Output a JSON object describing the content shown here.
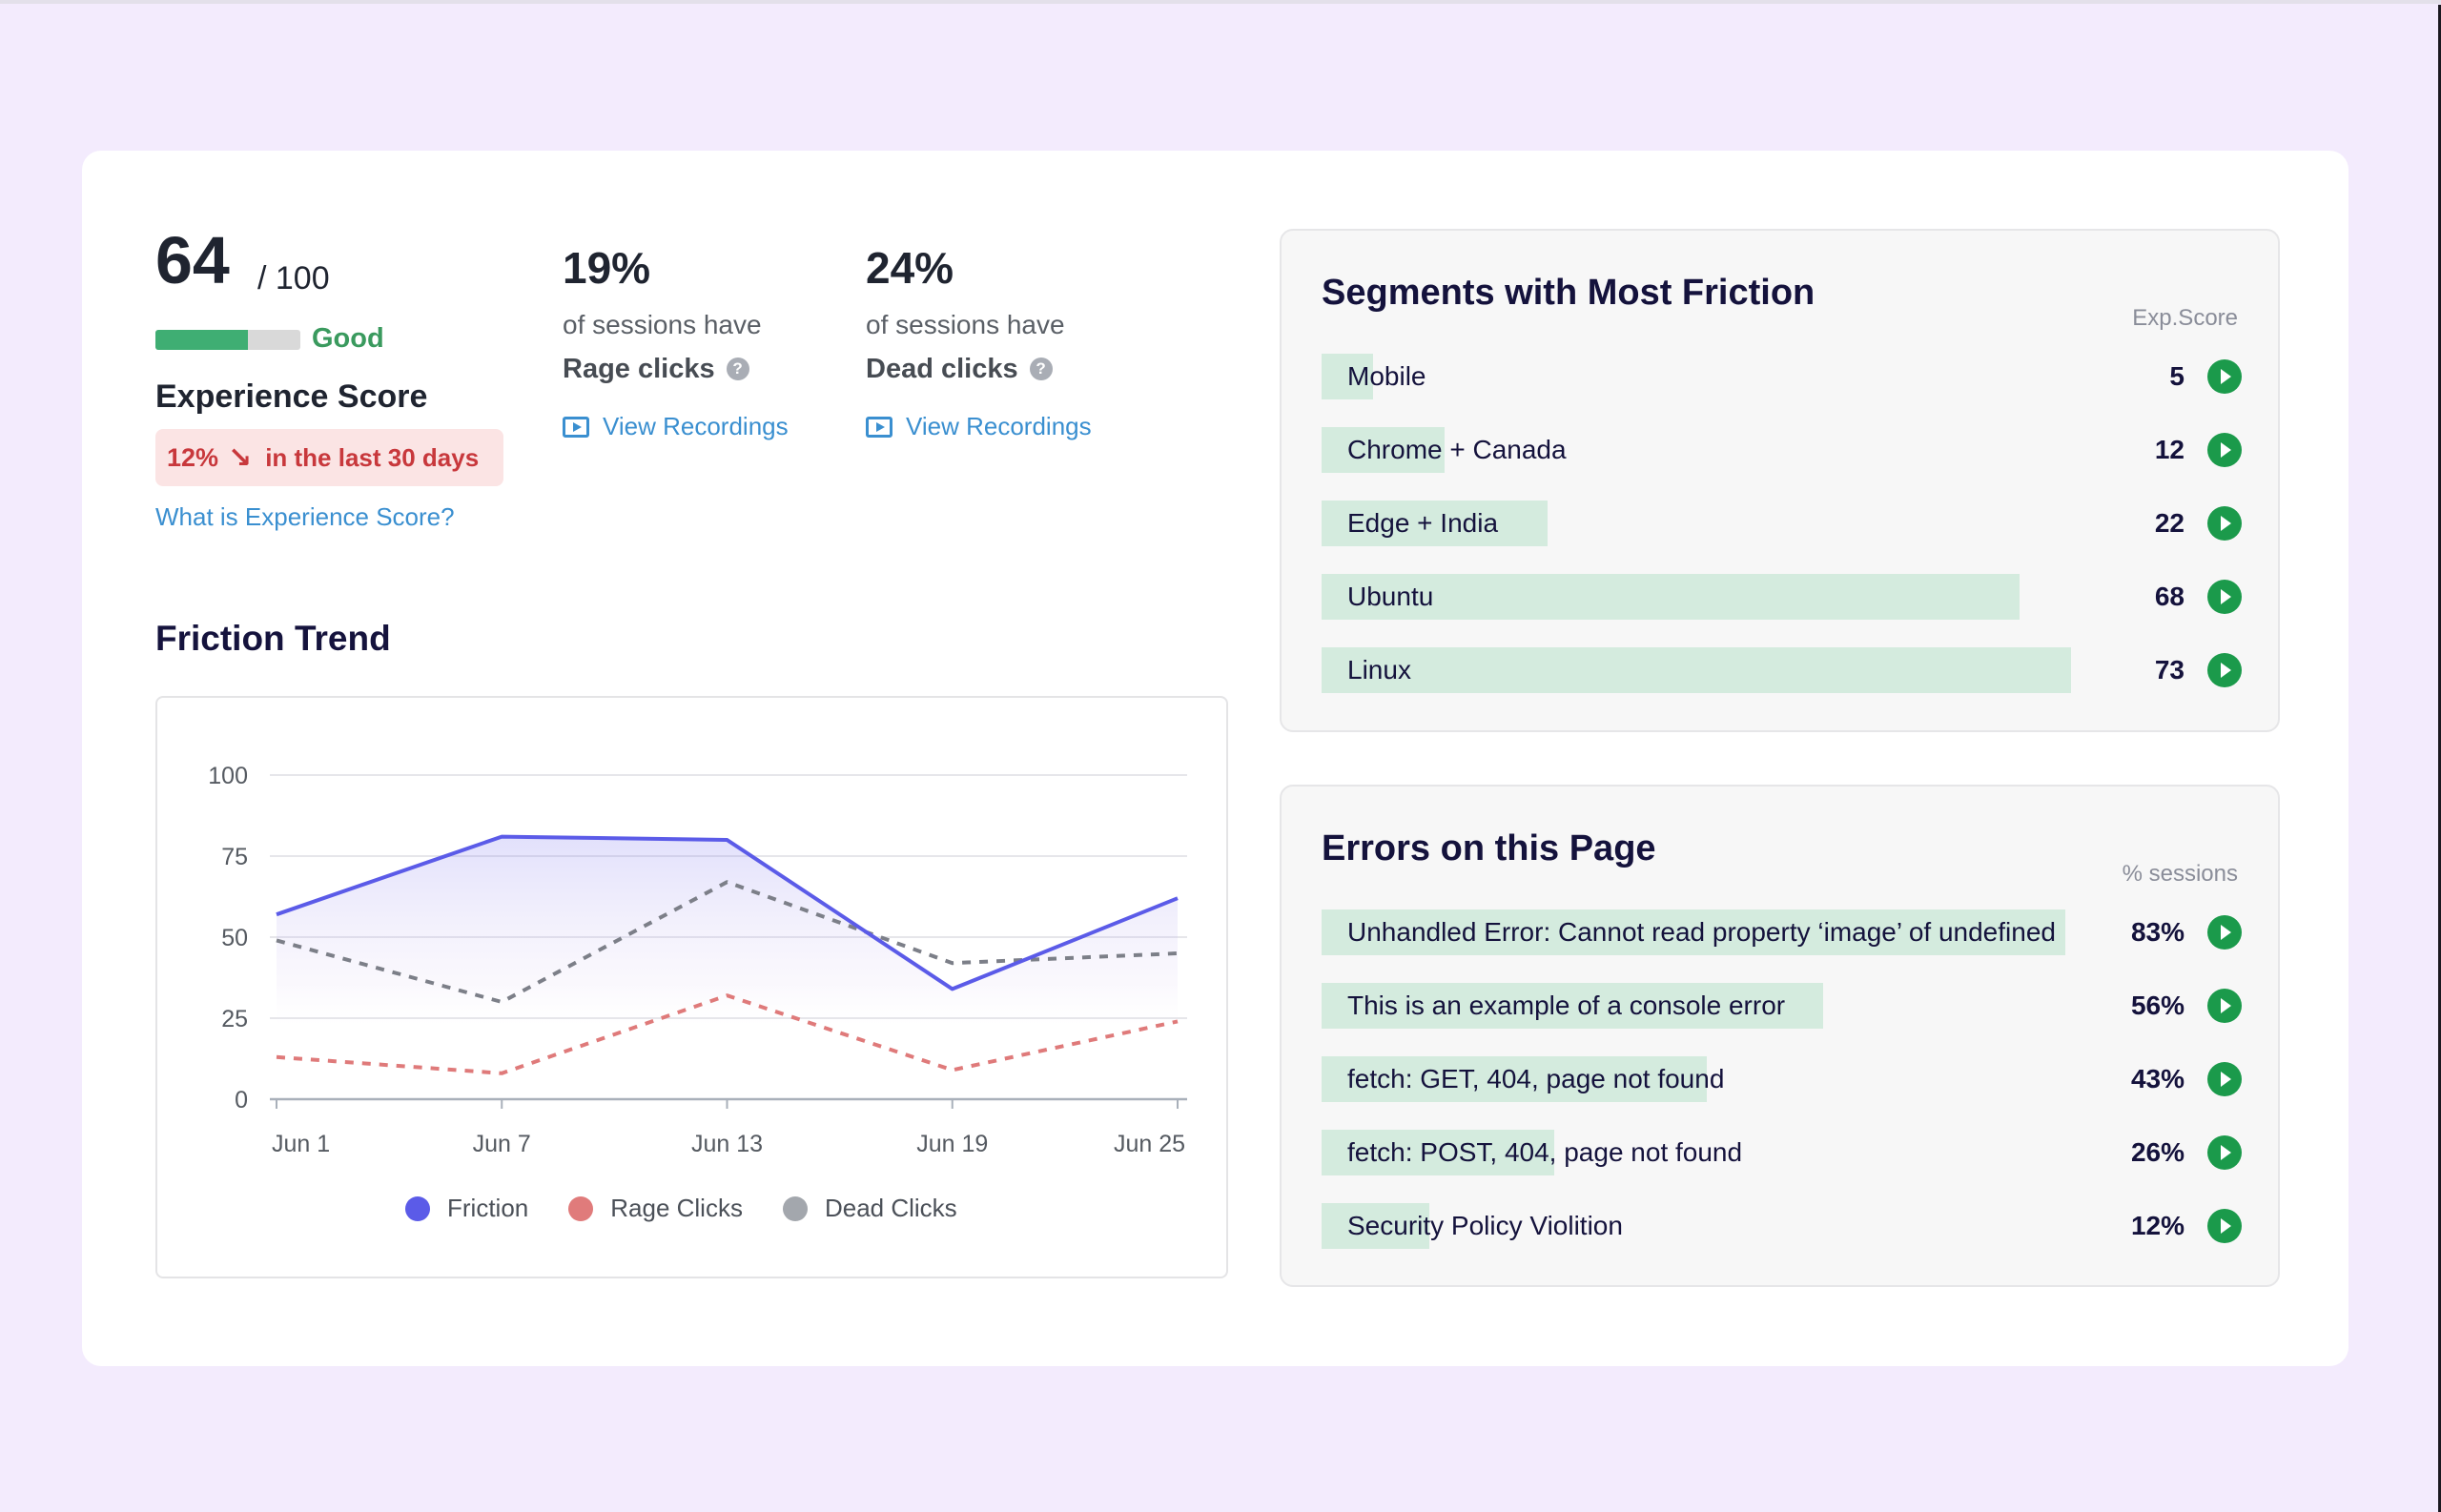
{
  "experience": {
    "score": "64",
    "max": "/ 100",
    "score_fraction": 0.64,
    "rating": "Good",
    "title": "Experience Score",
    "trend_value": "12%",
    "trend_arrow": "↘",
    "trend_period": "in the last 30 days",
    "help_link": "What is Experience Score?"
  },
  "stats": [
    {
      "value": "19%",
      "subtitle": "of sessions have",
      "kind": "Rage clicks",
      "help": "?",
      "link": "View Recordings"
    },
    {
      "value": "24%",
      "subtitle": "of sessions have",
      "kind": "Dead clicks",
      "help": "?",
      "link": "View Recordings"
    }
  ],
  "friction_trend": {
    "title": "Friction Trend"
  },
  "chart_data": {
    "type": "line",
    "title": "Friction Trend",
    "x": [
      "Jun 1",
      "Jun 7",
      "Jun 13",
      "Jun 19",
      "Jun 25"
    ],
    "ylim": [
      0,
      100
    ],
    "yticks": [
      0,
      25,
      50,
      75,
      100
    ],
    "grid": true,
    "legend_position": "bottom",
    "series": [
      {
        "name": "Friction",
        "color": "#5b5be8",
        "style": "solid",
        "area": true,
        "values": [
          57,
          81,
          80,
          34,
          62
        ]
      },
      {
        "name": "Rage Clicks",
        "color": "#df7a7a",
        "style": "dashed",
        "values": [
          13,
          8,
          32,
          9,
          24
        ]
      },
      {
        "name": "Dead Clicks",
        "color": "#7c7f88",
        "style": "dashed",
        "values": [
          49,
          30,
          67,
          42,
          45
        ]
      }
    ],
    "legend_colors": [
      "#5b5be8",
      "#e07b7b",
      "#a3a7ad"
    ]
  },
  "segments": {
    "title": "Segments with Most Friction",
    "column": "Exp.Score",
    "rows": [
      {
        "label": "Mobile",
        "value": "5",
        "score": 5
      },
      {
        "label": "Chrome + Canada",
        "value": "12",
        "score": 12
      },
      {
        "label": "Edge + India",
        "value": "22",
        "score": 22
      },
      {
        "label": "Ubuntu",
        "value": "68",
        "score": 68
      },
      {
        "label": "Linux",
        "value": "73",
        "score": 73
      }
    ]
  },
  "errors": {
    "title": "Errors on this Page",
    "column": "% sessions",
    "rows": [
      {
        "label": "Unhandled Error: Cannot read property ‘image’ of undefined",
        "value": "83%",
        "percent": 83
      },
      {
        "label": "This is an example of a console error",
        "value": "56%",
        "percent": 56
      },
      {
        "label": "fetch: GET, 404, page not found",
        "value": "43%",
        "percent": 43
      },
      {
        "label": "fetch: POST, 404, page not found",
        "value": "26%",
        "percent": 26
      },
      {
        "label": "Security Policy Violition",
        "value": "12%",
        "percent": 12
      }
    ]
  }
}
